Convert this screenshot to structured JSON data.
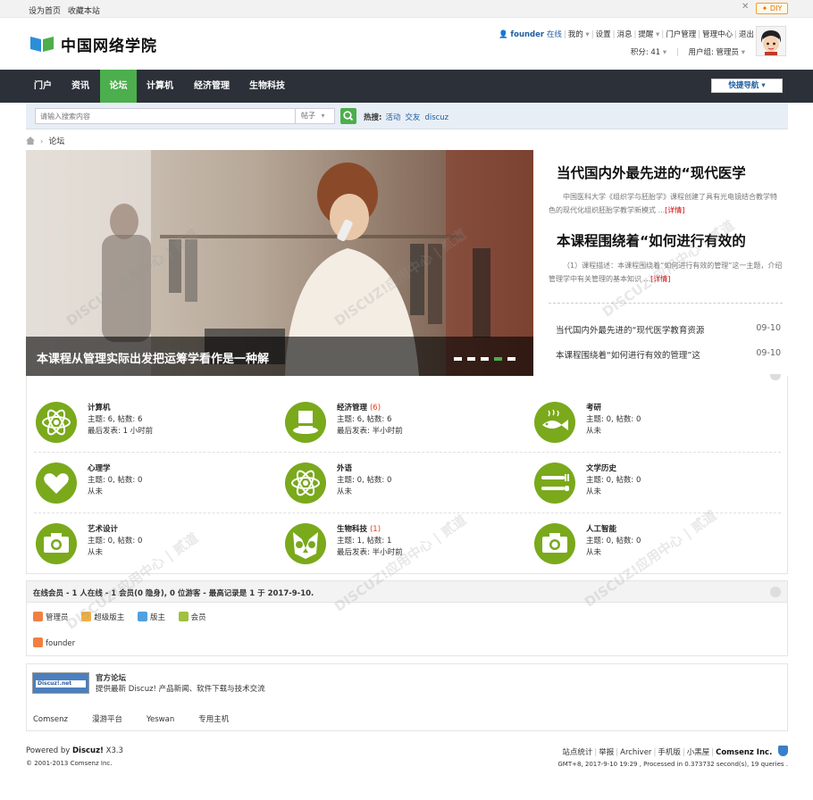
{
  "topbar": {
    "set_home": "设为首页",
    "bookmark": "收藏本站",
    "diy_label": "DIY",
    "close_icon": "expand-collapse-icon"
  },
  "header": {
    "site_name": "中国网络学院",
    "user_name": "founder",
    "user_status": "在线",
    "menu": [
      "我的",
      "设置",
      "消息",
      "提醒",
      "门户管理",
      "管理中心",
      "退出"
    ],
    "points_label": "积分: 41",
    "group_label": "用户组: 管理员"
  },
  "nav": {
    "items": [
      "门户",
      "资讯",
      "论坛",
      "计算机",
      "经济管理",
      "生物科技"
    ],
    "active_index": 2,
    "quick_nav": "快捷导航"
  },
  "search": {
    "placeholder": "请输入搜索内容",
    "type": "帖子",
    "hot_label": "热搜:",
    "hot_words": [
      "活动",
      "交友",
      "discuz"
    ]
  },
  "breadcrumb": {
    "current": "论坛"
  },
  "slider": {
    "caption": "本课程从管理实际出发把运筹学看作是一种解",
    "dots_count": 5,
    "active_dot": 3
  },
  "side": {
    "articles": [
      {
        "title": "当代国内外最先进的“现代医学",
        "summary": "中国医科大学《组织学与胚胎学》课程创建了具有光电镜结合教学特色的现代化组织胚胎学教学新模式 ...",
        "more": "[详情]"
      },
      {
        "title": "本课程围绕着“如何进行有效的",
        "summary": "（1）课程描述：本课程围绕着“如何进行有效的管理”这一主题，介绍管理学中有关管理的基本知识 ...",
        "more": "[详情]"
      }
    ],
    "list": [
      {
        "title": "当代国内外最先进的“现代医学教育资源",
        "date": "09-10"
      },
      {
        "title": "本课程围绕着“如何进行有效的管理”这",
        "date": "09-10"
      }
    ]
  },
  "forums": [
    {
      "name": "计算机",
      "today": "",
      "stats": "主题: 6, 帖数: 6",
      "last": "最后发表: 1 小时前",
      "icon": "atom-icon"
    },
    {
      "name": "经济管理",
      "today": "(6)",
      "stats": "主题: 6, 帖数: 6",
      "last": "最后发表: 半小时前",
      "icon": "top-hat-icon"
    },
    {
      "name": "考研",
      "today": "",
      "stats": "主题: 0, 帖数: 0",
      "last": "从未",
      "icon": "fish-icon"
    },
    {
      "name": "心理学",
      "today": "",
      "stats": "主题: 0, 帖数: 0",
      "last": "从未",
      "icon": "heart-icon"
    },
    {
      "name": "外语",
      "today": "",
      "stats": "主题: 0, 帖数: 0",
      "last": "从未",
      "icon": "atom-icon"
    },
    {
      "name": "文学历史",
      "today": "",
      "stats": "主题: 0, 帖数: 0",
      "last": "从未",
      "icon": "cutlery-icon"
    },
    {
      "name": "艺术设计",
      "today": "",
      "stats": "主题: 0, 帖数: 0",
      "last": "从未",
      "icon": "camera-icon"
    },
    {
      "name": "生物科技",
      "today": "(1)",
      "stats": "主题: 1, 帖数: 1",
      "last": "最后发表: 半小时前",
      "icon": "owl-icon"
    },
    {
      "name": "人工智能",
      "today": "",
      "stats": "主题: 0, 帖数: 0",
      "last": "从未",
      "icon": "camera-icon"
    }
  ],
  "online": {
    "title": "在线会员 - 1 人在线 - 1 会员(0 隐身), 0 位游客 - 最高记录是 1 于 2017-9-10.",
    "legend": [
      "管理员",
      "超级版主",
      "版主",
      "会员"
    ],
    "users": [
      "founder"
    ]
  },
  "links": {
    "logo_text": "Discuz!.net",
    "title": "官方论坛",
    "desc": "提供最新 Discuz! 产品新闻、软件下载与技术交流",
    "list": [
      "Comsenz",
      "漫游平台",
      "Yeswan",
      "专用主机"
    ]
  },
  "footer": {
    "powered_prefix": "Powered by",
    "powered_brand": "Discuz!",
    "version": "X3.3",
    "copyright": "© 2001-2013 Comsenz Inc.",
    "links": [
      "站点统计",
      "举报",
      "Archiver",
      "手机版",
      "小黑屋"
    ],
    "company": "Comsenz Inc.",
    "stats": "GMT+8, 2017-9-10 19:29 , Processed in 0.373732 second(s), 19 queries ."
  },
  "watermark": "DISCUZ!应用中心 | 贰道",
  "colors": {
    "accent": "#4cae4c",
    "nav_bg": "#2c3039",
    "forum_icon": "#7aa91c",
    "link": "#2060a0"
  }
}
